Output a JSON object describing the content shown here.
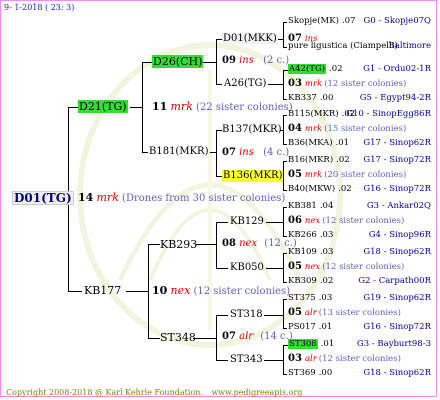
{
  "header": {
    "date": "9-  1-2018 ( 23:  3)"
  },
  "footer": {
    "copyright": "Copyright 2008-2018 @ Karl Kehrle Foundation.",
    "site": "www.pedigreeapis.org"
  },
  "gen0": {
    "id": "D01(TG)"
  },
  "gen1": [
    {
      "id": "D21(TG)"
    },
    {
      "line_num": "14",
      "marker": "mrk",
      "note": "(Drones from 30 sister colonies)"
    },
    {
      "id": "KB177"
    }
  ],
  "gen2": [
    {
      "id": "D26(CH)"
    },
    {
      "line_num": "11",
      "marker": "mrk",
      "note": "(22 sister colonies)"
    },
    {
      "id": "B181(MKR)"
    },
    {
      "id": "KB293"
    },
    {
      "line_num": "10",
      "marker": "nex",
      "note": "(12 sister colonies)"
    },
    {
      "id": "ST348"
    }
  ],
  "gen3": [
    {
      "id": "D01(MKK)"
    },
    {
      "line_num": "09",
      "marker": "ins",
      "note": "(2 c.)"
    },
    {
      "id": "A26(TG)"
    },
    {
      "id": "B137(MKR)"
    },
    {
      "line_num": "07",
      "marker": "ins",
      "note": "(4 c.)"
    },
    {
      "id": "B136(MKR)"
    },
    {
      "id": "KB129"
    },
    {
      "line_num": "08",
      "marker": "nex",
      "note": "(12 c.)"
    },
    {
      "id": "KB050"
    },
    {
      "id": "ST318"
    },
    {
      "line_num": "07",
      "marker": "alr",
      "note": "(14 c.)"
    },
    {
      "id": "ST343"
    }
  ],
  "gen4": [
    {
      "id": "Skopje(MK)",
      "num": ".07",
      "loc": "G0 - Skopje07Q"
    },
    {
      "line_num": "07",
      "marker": "ins",
      "note": ""
    },
    {
      "id": "pure ligustica (Ciampelli)",
      "num": "",
      "loc": "Baltimore"
    },
    {
      "id": "A42(TG)",
      "num": ".02",
      "loc": "G1 - Ordu02-1R"
    },
    {
      "line_num": "03",
      "marker": "mrk",
      "note": "(12 sister colonies)"
    },
    {
      "id": "KB337",
      "num": ".00",
      "loc": "G5 - Egypt94-2R"
    },
    {
      "id": "B115(MKR)",
      "num": ".02",
      "loc": "G10 - SinopEgg86R"
    },
    {
      "line_num": "04",
      "marker": "mrk",
      "note": "(15 sister colonies)"
    },
    {
      "id": "B36(MKA)",
      "num": ".01",
      "loc": "G17 - Sinop62R"
    },
    {
      "id": "B16(MKR)",
      "num": ".02",
      "loc": "G17 - Sinop72R"
    },
    {
      "line_num": "05",
      "marker": "mrk",
      "note": "(20 sister colonies)"
    },
    {
      "id": "B40(MKW)",
      "num": ".02",
      "loc": "G16 - Sinop72R"
    },
    {
      "id": "KB381",
      "num": ".04",
      "loc": "G3 - Ankar02Q"
    },
    {
      "line_num": "06",
      "marker": "nex",
      "note": "(12 sister colonies)"
    },
    {
      "id": "KB266",
      "num": ".03",
      "loc": "G4 - Sinop96R"
    },
    {
      "id": "KB109",
      "num": ".03",
      "loc": "G18 - Sinop62R"
    },
    {
      "line_num": "05",
      "marker": "nex",
      "note": "(12 sister colonies)"
    },
    {
      "id": "KB309",
      "num": ".02",
      "loc": "G2 - Carpath00R"
    },
    {
      "id": "ST375",
      "num": ".03",
      "loc": "G19 - Sinop62R"
    },
    {
      "line_num": "05",
      "marker": "alr",
      "note": "(13 sister colonies)"
    },
    {
      "id": "PS017",
      "num": ".01",
      "loc": "G16 - Sinop72R"
    },
    {
      "id": "ST308",
      "num": ".01",
      "loc": "G3 - Bayburt98-3"
    },
    {
      "line_num": "03",
      "marker": "alr",
      "note": "(12 sister colonies)"
    },
    {
      "id": "ST369",
      "num": ".00",
      "loc": "G18 - Sinop62R"
    }
  ]
}
